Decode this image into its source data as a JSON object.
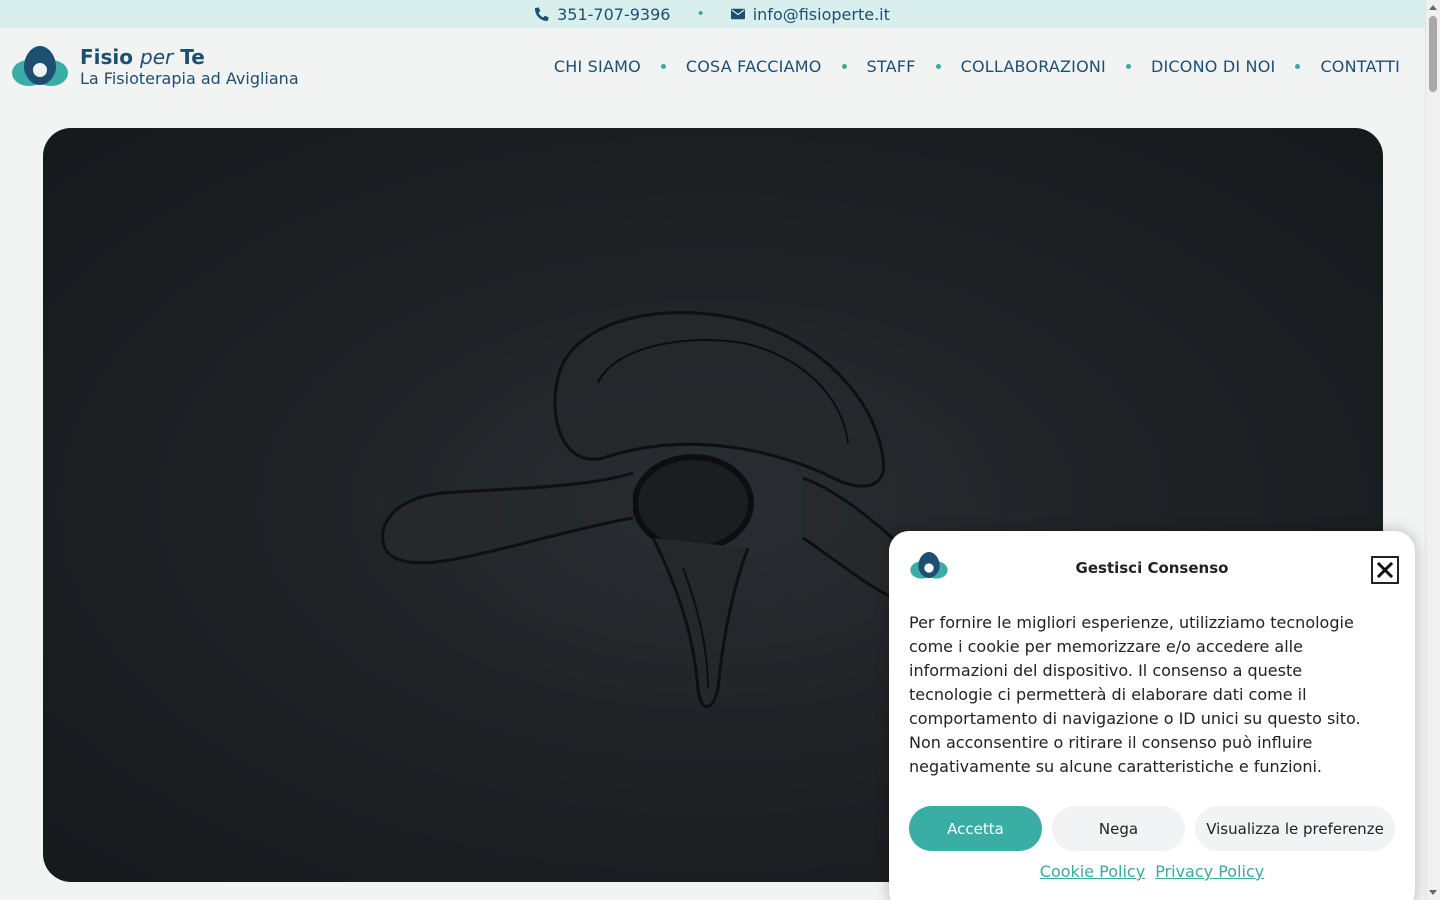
{
  "topbar": {
    "phone": "351-707-9396",
    "email": "info@fisioperte.it",
    "separator": "•",
    "phone_icon": "phone-icon",
    "email_icon": "envelope-icon"
  },
  "brand": {
    "title_part1": "Fisio",
    "title_part2": "per",
    "title_part3": "Te",
    "subtitle": "La Fisioterapia ad Avigliana"
  },
  "nav": {
    "items": [
      "CHI SIAMO",
      "COSA FACCIAMO",
      "STAFF",
      "COLLABORAZIONI",
      "DICONO DI NOI",
      "CONTATTI"
    ]
  },
  "hero": {
    "image": "vertebra-illustration"
  },
  "cookie": {
    "title": "Gestisci Consenso",
    "text": "Per fornire le migliori esperienze, utilizziamo tecnologie come i cookie per memorizzare e/o accedere alle informazioni del dispositivo. Il consenso a queste tecnologie ci permetterà di elaborare dati come il comportamento di navigazione o ID unici su questo sito. Non acconsentire o ritirare il consenso può influire negativamente su alcune caratteristiche e funzioni.",
    "accept_label": "Accetta",
    "deny_label": "Nega",
    "prefs_label": "Visualizza le preferenze",
    "cookie_policy_label": "Cookie Policy",
    "privacy_policy_label": "Privacy Policy"
  },
  "colors": {
    "primary": "#1d4f73",
    "accent": "#3aa9a1",
    "topbar_bg": "#d9efed",
    "accept_bg": "#3aada5"
  }
}
